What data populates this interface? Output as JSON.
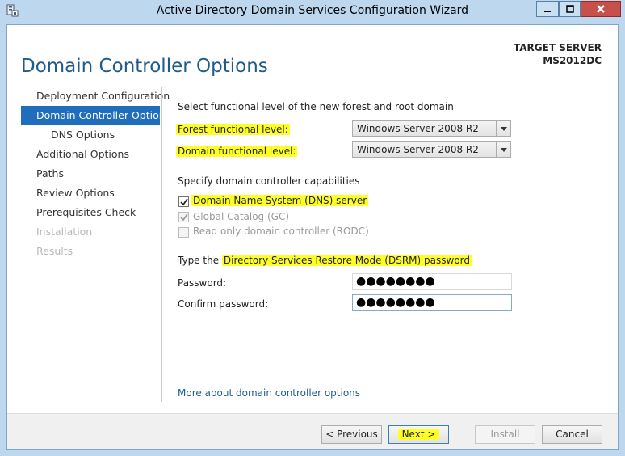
{
  "window": {
    "title": "Active Directory Domain Services Configuration Wizard",
    "accent_color": "#1f6dbb",
    "highlight_color": "#ffff28"
  },
  "header": {
    "page_title": "Domain Controller Options",
    "target_label": "TARGET SERVER",
    "target_name": "MS2012DC"
  },
  "nav": {
    "items": [
      {
        "label": "Deployment Configuration",
        "state": "normal"
      },
      {
        "label": "Domain Controller Options",
        "state": "active"
      },
      {
        "label": "DNS Options",
        "state": "normal"
      },
      {
        "label": "Additional Options",
        "state": "normal"
      },
      {
        "label": "Paths",
        "state": "normal"
      },
      {
        "label": "Review Options",
        "state": "normal"
      },
      {
        "label": "Prerequisites Check",
        "state": "normal"
      },
      {
        "label": "Installation",
        "state": "disabled"
      },
      {
        "label": "Results",
        "state": "disabled"
      }
    ]
  },
  "functional_level": {
    "heading": "Select functional level of the new forest and root domain",
    "forest_label": "Forest functional level:",
    "forest_value": "Windows Server 2008 R2",
    "domain_label": "Domain functional level:",
    "domain_value": "Windows Server 2008 R2"
  },
  "capabilities": {
    "heading": "Specify domain controller capabilities",
    "dns_label": "Domain Name System (DNS) server",
    "dns_checked": true,
    "gc_label": "Global Catalog (GC)",
    "gc_checked": true,
    "rodc_label": "Read only domain controller (RODC)",
    "rodc_checked": false
  },
  "dsrm": {
    "heading_prefix": "Type the",
    "heading_highlight": "Directory Services Restore Mode (DSRM) password",
    "password_label": "Password:",
    "password_value": "●●●●●●●●",
    "confirm_label": "Confirm password:",
    "confirm_value": "●●●●●●●●"
  },
  "more_link": "More about domain controller options",
  "buttons": {
    "previous": "< Previous",
    "next": "Next >",
    "install": "Install",
    "cancel": "Cancel"
  }
}
